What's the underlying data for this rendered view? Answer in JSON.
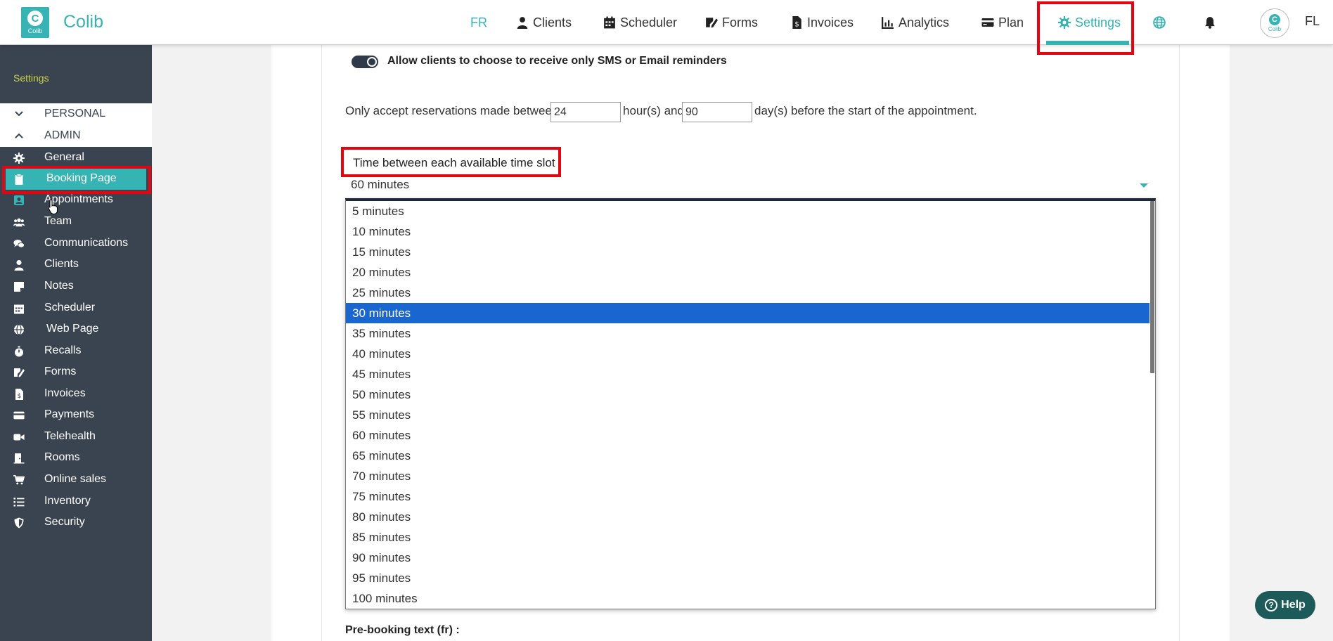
{
  "app": {
    "brand": "Colib",
    "logo_text": "Colib",
    "user_initials": "FL",
    "accent": "#36b3b3",
    "sidebar_bg": "#3a4350",
    "highlight": "#e20613"
  },
  "nav": {
    "lang": "FR",
    "clients": "Clients",
    "scheduler": "Scheduler",
    "forms": "Forms",
    "invoices": "Invoices",
    "analytics": "Analytics",
    "plan": "Plan",
    "settings": "Settings"
  },
  "sidebar": {
    "title": "Settings",
    "sections": {
      "personal": "PERSONAL",
      "admin": "ADMIN"
    },
    "items": [
      {
        "label": "General",
        "icon": "gear-icon"
      },
      {
        "label": "Booking Page",
        "icon": "clipboard-icon",
        "active": true
      },
      {
        "label": "Appointments",
        "icon": "contact-card-icon"
      },
      {
        "label": "Team",
        "icon": "team-icon"
      },
      {
        "label": "Communications",
        "icon": "chat-icon"
      },
      {
        "label": "Clients",
        "icon": "user-icon"
      },
      {
        "label": "Notes",
        "icon": "note-icon"
      },
      {
        "label": "Scheduler",
        "icon": "calendar-icon"
      },
      {
        "label": "Web Page",
        "icon": "globe-icon"
      },
      {
        "label": "Recalls",
        "icon": "stopwatch-icon"
      },
      {
        "label": "Forms",
        "icon": "signature-icon"
      },
      {
        "label": "Invoices",
        "icon": "invoice-icon"
      },
      {
        "label": "Payments",
        "icon": "credit-card-icon"
      },
      {
        "label": "Telehealth",
        "icon": "video-icon"
      },
      {
        "label": "Rooms",
        "icon": "door-icon"
      },
      {
        "label": "Online sales",
        "icon": "cart-icon"
      },
      {
        "label": "Inventory",
        "icon": "list-icon"
      },
      {
        "label": "Security",
        "icon": "shield-icon"
      }
    ]
  },
  "main": {
    "toggle_label": "Allow clients to choose to receive only SMS or Email reminders",
    "toggle_on": true,
    "reservation": {
      "prefix": "Only accept reservations made between",
      "hours_value": "24",
      "middle": "hour(s) and",
      "days_value": "90",
      "suffix": "day(s) before the start of the appointment."
    },
    "time_slot": {
      "label": "Time between each available time slot",
      "value": "60 minutes",
      "selected_index": 5,
      "options": [
        "5 minutes",
        "10 minutes",
        "15 minutes",
        "20 minutes",
        "25 minutes",
        "30 minutes",
        "35 minutes",
        "40 minutes",
        "45 minutes",
        "50 minutes",
        "55 minutes",
        "60 minutes",
        "65 minutes",
        "70 minutes",
        "75 minutes",
        "80 minutes",
        "85 minutes",
        "90 minutes",
        "95 minutes",
        "100 minutes"
      ]
    },
    "prebooking_label": "Pre-booking text (fr) :"
  },
  "help_label": "Help"
}
